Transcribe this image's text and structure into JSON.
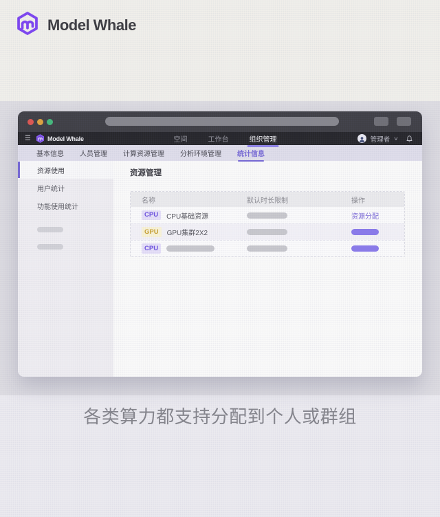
{
  "hero": {
    "brand": "Model Whale"
  },
  "browser": {
    "navbar": {
      "brand": "Model Whale",
      "links": [
        "空间",
        "工作台",
        "组织管理"
      ],
      "active_link": "组织管理",
      "user_name": "管理者"
    },
    "tabs": [
      "基本信息",
      "人员管理",
      "计算资源管理",
      "分析环境管理",
      "统计信息"
    ],
    "active_tab": "统计信息",
    "sidebar": {
      "items": [
        "资源使用",
        "用户统计",
        "功能使用统计"
      ],
      "active_item": "资源使用"
    },
    "content": {
      "page_title": "资源管理",
      "table": {
        "columns": [
          "名称",
          "默认时长限制",
          "操作"
        ],
        "rows": [
          {
            "badge": "CPU",
            "name": "CPU基础资源",
            "action": "资源分配"
          },
          {
            "badge": "GPU",
            "name": "GPU集群2X2"
          },
          {
            "badge": "CPU"
          }
        ]
      }
    }
  },
  "caption": "各类算力都支持分配到个人或群组",
  "icons": {
    "hamburger_glyph": "☰",
    "chevron_down_glyph": "∨"
  },
  "colors": {
    "brand_purple": "#7d45f2",
    "accent_purple": "#7668d6",
    "link_purple": "#7a68d8",
    "action_pill_purple": "#8a7aec",
    "cpu_badge_bg": "#e7e1fa",
    "cpu_badge_text": "#6b4fe0",
    "gpu_badge_bg": "#faf4d7",
    "gpu_badge_text": "#c9a234",
    "traffic_red": "#dd5550",
    "traffic_yellow": "#dfa33d",
    "traffic_green": "#43b97b"
  }
}
